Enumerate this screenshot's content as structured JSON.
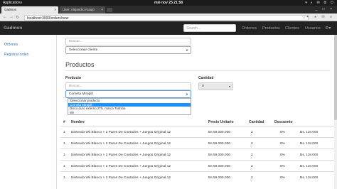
{
  "os": {
    "apps_label": "Applications",
    "clock": "mié nov 25  21:58"
  },
  "tabs": [
    {
      "title": "Gadmon"
    },
    {
      "title": "User: Alejandro Araujo"
    }
  ],
  "address": {
    "url": "localhost:3000/orders/new"
  },
  "navbar": {
    "brand": "Gadmon",
    "search_placeholder": "Search...",
    "links": [
      "Ordenes",
      "Productos",
      "Clientes",
      "Usuarios"
    ]
  },
  "sidebar": {
    "items": [
      "Ordenes",
      "Registrar orden"
    ]
  },
  "client": {
    "search_placeholder": "Buscar...",
    "select_value": "Seleccionar cliente"
  },
  "products": {
    "heading": "Productos",
    "product_label": "Producto",
    "quantity_label": "Cantidad",
    "search_placeholder": "Buscar...",
    "select_value": "Corneta Mirapill",
    "quantity_value": "0",
    "options": [
      {
        "label": "Seleccionar producto",
        "selected": false
      },
      {
        "label": "Corneta Mirapill",
        "selected": true
      },
      {
        "label": "Disco duro externo 2Tb, marca Toshiba",
        "selected": false
      },
      {
        "label": "Wii",
        "selected": false
      }
    ]
  },
  "table": {
    "headers": [
      "#",
      "Nombre",
      "Precio Unitario",
      "Cantidad",
      "Descuento",
      ""
    ],
    "rows": [
      {
        "n": "1",
        "nombre": "Nintendo Wii Blanco + 2 Pares De Controles + Juegos Original 12",
        "precio": "Bs 59.000.000",
        "cantidad": "2",
        "descuento": "0%",
        "total": "Bs. 118.000"
      },
      {
        "n": "1",
        "nombre": "Nintendo Wii Blanco + 2 Pares De Controles + Juegos Original 12",
        "precio": "Bs 59.000.000",
        "cantidad": "2",
        "descuento": "0%",
        "total": "Bs. 118.000"
      },
      {
        "n": "1",
        "nombre": "Nintendo Wii Blanco + 2 Pares De Controles + Juegos Original 12",
        "precio": "Bs 59.000.000",
        "cantidad": "2",
        "descuento": "0%",
        "total": "Bs. 118.000"
      },
      {
        "n": "1",
        "nombre": "Nintendo Wii Blanco + 2 Pares De Controles + Juegos Original 12",
        "precio": "Bs 59.000.000",
        "cantidad": "2",
        "descuento": "0%",
        "total": "Bs. 118.000"
      },
      {
        "n": "1",
        "nombre": "Nintendo Wii Blanco + 2 Pares De Controles + Juegos Original 12",
        "precio": "Bs 59.000.000",
        "cantidad": "2",
        "descuento": "0%",
        "total": "Bs. 118.000"
      }
    ]
  },
  "colors": {
    "navbar_bg": "#222222",
    "link": "#337ab7",
    "selected_option": "#1e90ff"
  }
}
